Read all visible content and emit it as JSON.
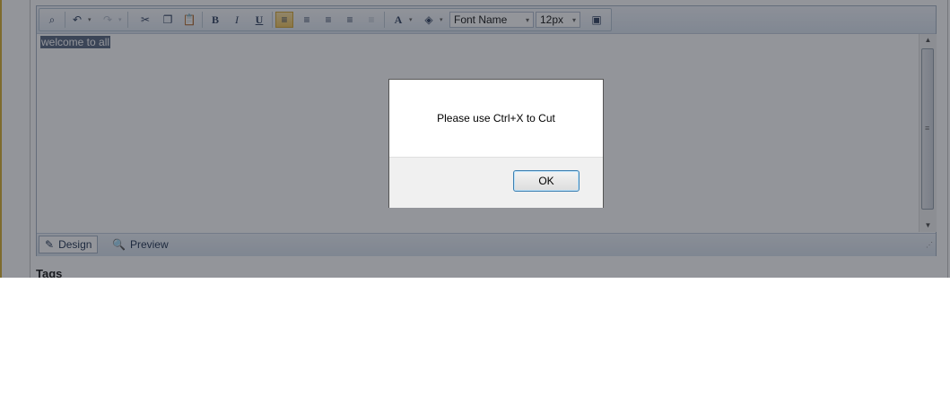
{
  "editor": {
    "content": "welcome to all",
    "font_name": "Font Name",
    "font_size": "12px",
    "toolbar": {
      "find_glyph": "⌕",
      "undo_glyph": "↶",
      "redo_glyph": "↷",
      "cut_glyph": "✂",
      "copy_glyph": "❐",
      "paste_glyph": "📋",
      "bold": "B",
      "italic": "I",
      "underline": "U",
      "font_color_glyph": "A",
      "highlight_glyph": "◈",
      "image_glyph": "▣",
      "dropdown_glyph": "▾",
      "align_glyph": "≡"
    },
    "modes": {
      "design_label": "Design",
      "design_icon": "✎",
      "preview_label": "Preview",
      "preview_icon": "🔍"
    },
    "scroll": {
      "up": "▲",
      "down": "▼",
      "grip": "≡"
    },
    "resize_grip": "⋰"
  },
  "dialog": {
    "message": "Please use Ctrl+X to Cut",
    "ok_label": "OK"
  },
  "page": {
    "tags_label": "Tags"
  },
  "colors": {
    "accent": "#3c7fb1",
    "active_button": "#f3c862",
    "selection": "#5f6e86"
  }
}
